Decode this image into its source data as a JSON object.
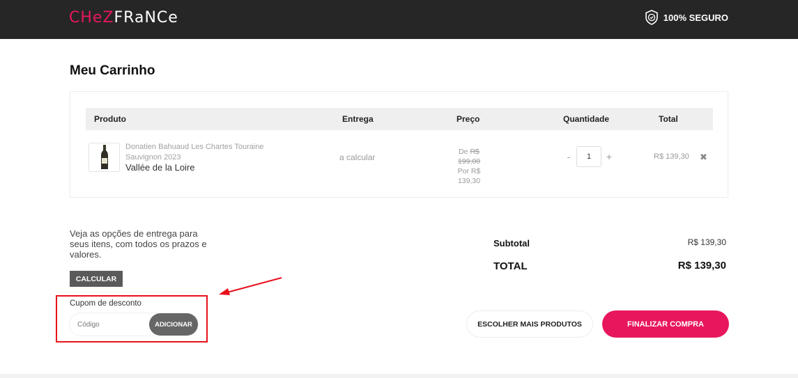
{
  "header": {
    "logo_part1": "CHeZ",
    "logo_part2": "FRaNCe",
    "secure_label": "100% SEGURO"
  },
  "page": {
    "title": "Meu Carrinho"
  },
  "cart_table": {
    "columns": [
      "Produto",
      "Entrega",
      "Preço",
      "Quantidade",
      "Total"
    ],
    "items": [
      {
        "name": "Donatien Bahuaud Les Chartes Touraine Sauvignon 2023",
        "region": "Vallée de la Loire",
        "delivery": "a calcular",
        "price_old_prefix": "De",
        "price_old": "R$ 199,00",
        "price_new": "Por R$ 139,30",
        "quantity": "1",
        "total": "R$ 139,30"
      }
    ]
  },
  "shipping": {
    "text": "Veja as opções de entrega para seus itens, com todos os prazos e valores.",
    "button_label": "CALCULAR"
  },
  "coupon": {
    "label": "Cupom de desconto",
    "placeholder": "Código",
    "button_label": "ADICIONAR"
  },
  "summary": {
    "subtotal_label": "Subtotal",
    "subtotal_value": "R$ 139,30",
    "total_label": "TOTAL",
    "total_value": "R$ 139,30"
  },
  "actions": {
    "continue_label": "ESCOLHER MAIS PRODUTOS",
    "checkout_label": "FINALIZAR COMPRA"
  },
  "colors": {
    "brand_pink": "#e8175d",
    "header_bg": "#262626",
    "annotation_red": "#e8101b"
  },
  "icons": {
    "secure": "shield-check-icon",
    "remove": "close-icon",
    "product": "wine-bottle-icon"
  }
}
